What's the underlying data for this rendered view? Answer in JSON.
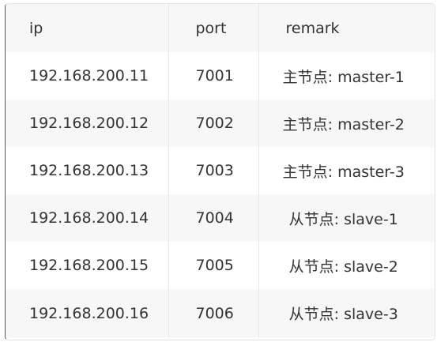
{
  "table": {
    "columns": [
      "ip",
      "port",
      "remark"
    ],
    "rows": [
      {
        "ip": "192.168.200.11",
        "port": "7001",
        "remark": "主节点: master-1"
      },
      {
        "ip": "192.168.200.12",
        "port": "7002",
        "remark": "主节点: master-2"
      },
      {
        "ip": "192.168.200.13",
        "port": "7003",
        "remark": "主节点: master-3"
      },
      {
        "ip": "192.168.200.14",
        "port": "7004",
        "remark": "从节点: slave-1"
      },
      {
        "ip": "192.168.200.15",
        "port": "7005",
        "remark": "从节点: slave-2"
      },
      {
        "ip": "192.168.200.16",
        "port": "7006",
        "remark": "从节点: slave-3"
      }
    ]
  }
}
